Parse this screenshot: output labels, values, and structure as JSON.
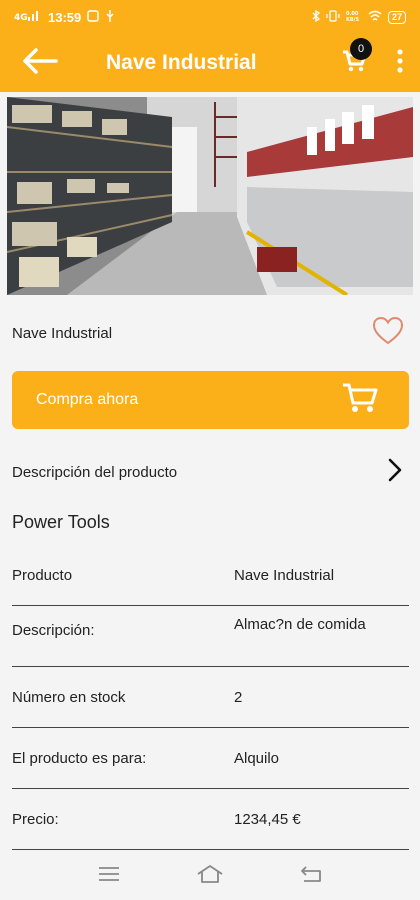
{
  "status": {
    "time": "13:59",
    "battery": "27"
  },
  "header": {
    "title": "Nave Industrial",
    "cart_count": "0"
  },
  "product": {
    "name": "Nave Industrial",
    "buy_label": "Compra ahora",
    "description_link": "Descripción del producto",
    "section_title": "Power Tools"
  },
  "specs": [
    {
      "label": "Producto",
      "value": "Nave Industrial"
    },
    {
      "label": "Descripción:",
      "value": "Almac?n de comida"
    },
    {
      "label": "Número en stock",
      "value": "2"
    },
    {
      "label": "El producto es para:",
      "value": "Alquilo"
    },
    {
      "label": "Precio:",
      "value": "1234,45 €"
    }
  ],
  "colors": {
    "accent": "#fbb019",
    "heart": "#e08a6e"
  },
  "icons": {
    "back": "arrow-left-icon",
    "cart": "cart-icon",
    "more": "more-vertical-icon",
    "heart": "heart-outline-icon",
    "chevron": "chevron-right-icon"
  }
}
